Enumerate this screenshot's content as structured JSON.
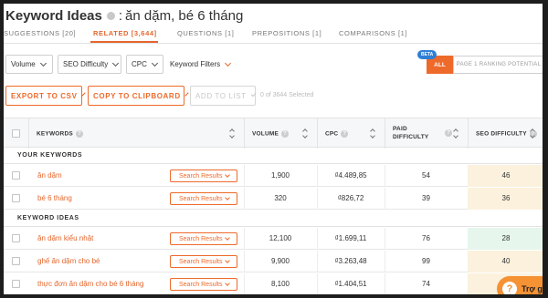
{
  "header": {
    "title": "Keyword Ideas",
    "separator": ":",
    "query": "ăn dặm, bé 6 tháng"
  },
  "tabs": [
    {
      "label": "SUGGESTIONS [20]",
      "active": false
    },
    {
      "label": "RELATED [3,644]",
      "active": true
    },
    {
      "label": "QUESTIONS [1]",
      "active": false
    },
    {
      "label": "PREPOSITIONS [1]",
      "active": false
    },
    {
      "label": "COMPARISONS [1]",
      "active": false
    }
  ],
  "filters": {
    "volume": "Volume",
    "seo_difficulty": "SEO Difficulty",
    "cpc": "CPC",
    "keyword_filters": "Keyword Filters"
  },
  "ranking_toggle": {
    "beta": "BETA",
    "all": "ALL",
    "page1": "PAGE 1 RANKING POTENTIAL"
  },
  "actions": {
    "export_csv": "EXPORT TO CSV",
    "copy_clipboard": "COPY TO CLIPBOARD",
    "add_to_list": "ADD TO LIST",
    "selected_count": "0 of 3644 Selected"
  },
  "table": {
    "columns": {
      "keywords": "KEYWORDS",
      "volume": "VOLUME",
      "cpc": "CPC",
      "paid_difficulty_line1": "PAID",
      "paid_difficulty_line2": "DIFFICULTY",
      "seo_difficulty": "SEO DIFFICULTY"
    },
    "help_glyph": "?",
    "sections": {
      "your_keywords": "YOUR KEYWORDS",
      "keyword_ideas": "KEYWORD IDEAS"
    },
    "search_results_label": "Search Results",
    "your_keywords": [
      {
        "keyword": "ăn dặm",
        "volume": "1,900",
        "cpc": "₫4.489,85",
        "paid": "54",
        "seo": "46",
        "seo_color": "#fbf1dd"
      },
      {
        "keyword": "bé 6 tháng",
        "volume": "320",
        "cpc": "₫826,72",
        "paid": "39",
        "seo": "36",
        "seo_color": "#fbf1dd"
      }
    ],
    "keyword_ideas": [
      {
        "keyword": "ăn dặm kiểu nhật",
        "volume": "12,100",
        "cpc": "₫1.699,11",
        "paid": "76",
        "seo": "28",
        "seo_color": "#e6f6ec"
      },
      {
        "keyword": "ghế ăn dặm cho bé",
        "volume": "9,900",
        "cpc": "₫3.263,48",
        "paid": "99",
        "seo": "40",
        "seo_color": "#fbf1dd"
      },
      {
        "keyword": "thực đơn ăn dặm cho bé 6 tháng",
        "volume": "8,100",
        "cpc": "₫1.404,51",
        "paid": "74",
        "seo": "",
        "seo_color": "#fbf1dd"
      }
    ]
  },
  "help_widget": {
    "icon": "?",
    "label": "Trợ giú"
  }
}
